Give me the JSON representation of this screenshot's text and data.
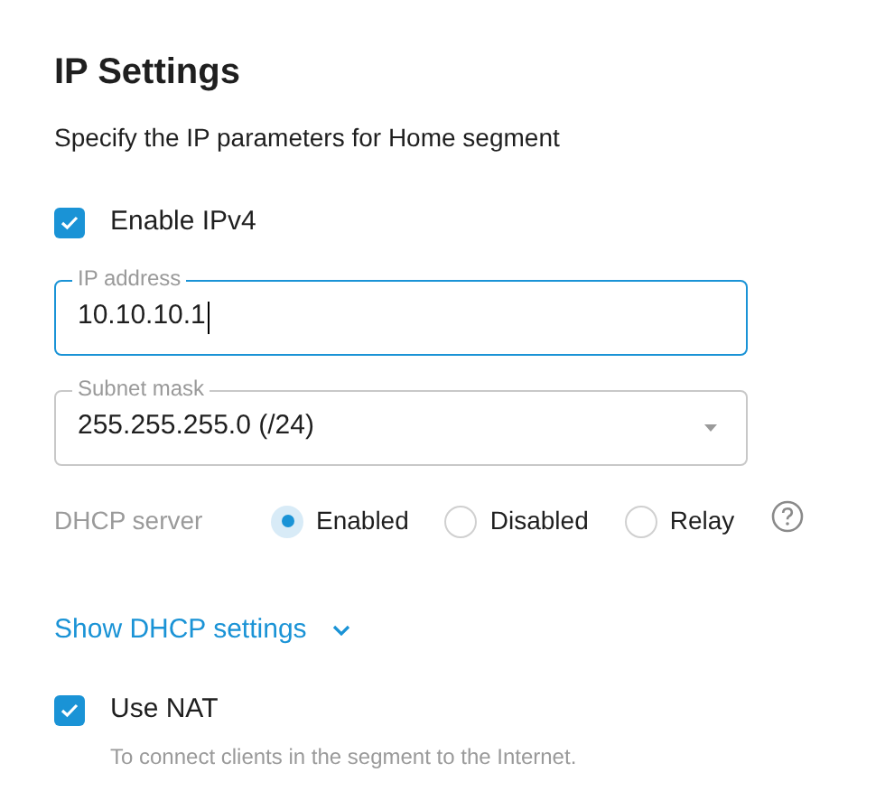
{
  "title": "IP Settings",
  "subtitle": "Specify the IP parameters for Home segment",
  "enable_ipv4": {
    "label": "Enable IPv4",
    "checked": true
  },
  "fields": [
    {
      "kind": "input",
      "label": "IP address",
      "value": "10.10.10.1",
      "focused": true
    },
    {
      "kind": "select",
      "label": "Subnet mask",
      "value": "255.255.255.0 (/24)",
      "focused": false
    }
  ],
  "dhcp_server": {
    "label": "DHCP server",
    "options": [
      {
        "label": "Enabled",
        "selected": true
      },
      {
        "label": "Disabled",
        "selected": false
      },
      {
        "label": "Relay",
        "selected": false
      }
    ]
  },
  "dhcp_toggle": {
    "label": "Show DHCP settings",
    "expanded": false
  },
  "use_nat": {
    "label": "Use NAT",
    "checked": true,
    "hint": "To connect clients in the segment to the Internet."
  }
}
